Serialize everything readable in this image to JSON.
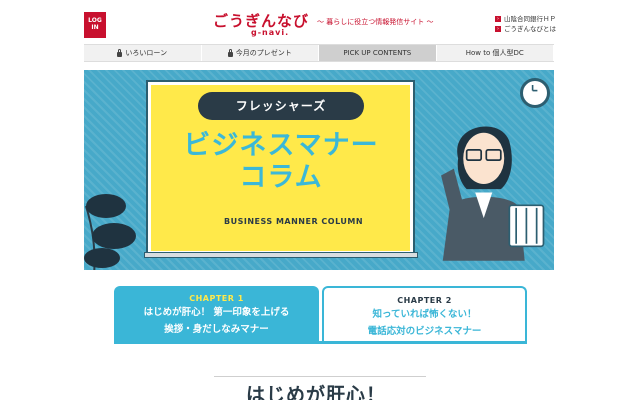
{
  "header": {
    "login_label": "LOG IN",
    "brand": "ごうぎんなび",
    "brand_sub": "g-navi.",
    "tagline": "〜 暮らしに役立つ情報発信サイト 〜",
    "links": [
      "山陰合同銀行ＨＰ",
      "ごうぎんなびとは"
    ]
  },
  "nav": {
    "items": [
      {
        "label": "いろいローン",
        "icon": "lock-icon"
      },
      {
        "label": "今月のプレゼント",
        "icon": "lock-icon"
      },
      {
        "label": "PICK UP CONTENTS"
      },
      {
        "label": "How to 個人型DC"
      }
    ]
  },
  "hero": {
    "pill": "フレッシャーズ",
    "title_line1": "ビジネスマナー",
    "title_line2": "コラム",
    "subtitle": "BUSINESS MANNER COLUMN"
  },
  "chapters": [
    {
      "num": "CHAPTER 1",
      "line1": "はじめが肝心！ 第一印象を上げる",
      "line2": "挨拶・身だしなみマナー"
    },
    {
      "num": "CHAPTER 2",
      "line1": "知っていれば怖くない！",
      "line2": "電話応対のビジネスマナー"
    }
  ],
  "section_title": "はじめが肝心！",
  "colors": {
    "brand_red": "#c8102e",
    "accent_blue": "#3ab6d7",
    "board_yellow": "#ffe94a"
  }
}
